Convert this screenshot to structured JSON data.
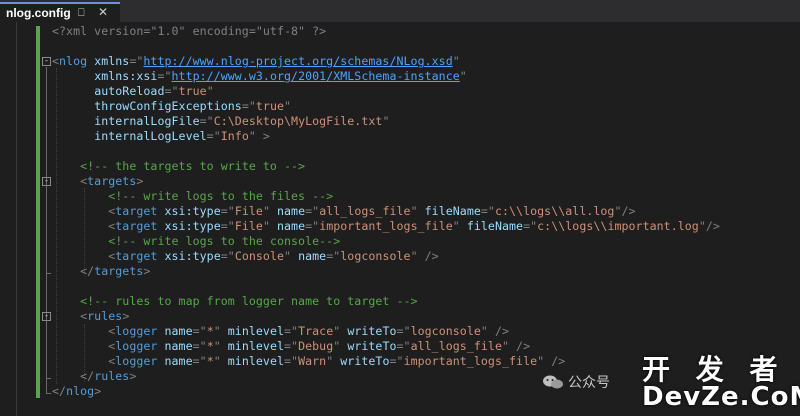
{
  "tab": {
    "title": "nlog.config",
    "pin_icon": "pin-icon",
    "close_icon": "close-icon"
  },
  "code": {
    "l1": {
      "s1": "<?xml version=\"1.0\" encoding=\"utf-8\" ?>"
    },
    "l2": {},
    "l3": {
      "s1": "<",
      "s2": "nlog",
      "s3": " ",
      "s4": "xmlns",
      "s5": "=\"",
      "s6": "http://www.nlog-project.org/schemas/NLog.xsd",
      "s7": "\""
    },
    "l4": {
      "s1": "      ",
      "s2": "xmlns:xsi",
      "s3": "=\"",
      "s4": "http://www.w3.org/2001/XMLSchema-instance",
      "s5": "\""
    },
    "l5": {
      "s1": "      ",
      "s2": "autoReload",
      "s3": "=\"",
      "s4": "true",
      "s5": "\""
    },
    "l6": {
      "s1": "      ",
      "s2": "throwConfigExceptions",
      "s3": "=\"",
      "s4": "true",
      "s5": "\""
    },
    "l7": {
      "s1": "      ",
      "s2": "internalLogFile",
      "s3": "=\"",
      "s4": "C:\\Desktop\\MyLogFile.txt",
      "s5": "\""
    },
    "l8": {
      "s1": "      ",
      "s2": "internalLogLevel",
      "s3": "=\"",
      "s4": "Info",
      "s5": "\" >"
    },
    "l9": {},
    "l10": {
      "s1": "    ",
      "s2": "<!-- the targets to write to -->"
    },
    "l11": {
      "s1": "    <",
      "s2": "targets",
      "s3": ">"
    },
    "l12": {
      "s1": "        ",
      "s2": "<!-- write logs to the files -->"
    },
    "l13": {
      "s1": "        <",
      "s2": "target",
      "s3": " ",
      "s4": "xsi:type",
      "s5": "=\"",
      "s6": "File",
      "s7": "\" ",
      "s8": "name",
      "s9": "=\"",
      "s10": "all_logs_file",
      "s11": "\" ",
      "s12": "fileName",
      "s13": "=\"",
      "s14": "c:\\\\logs\\\\all.log",
      "s15": "\"/>"
    },
    "l14": {
      "s1": "        <",
      "s2": "target",
      "s3": " ",
      "s4": "xsi:type",
      "s5": "=\"",
      "s6": "File",
      "s7": "\" ",
      "s8": "name",
      "s9": "=\"",
      "s10": "important_logs_file",
      "s11": "\" ",
      "s12": "fileName",
      "s13": "=\"",
      "s14": "c:\\\\logs\\\\important.log",
      "s15": "\"/>"
    },
    "l15": {
      "s1": "        ",
      "s2": "<!-- write logs to the console-->"
    },
    "l16": {
      "s1": "        <",
      "s2": "target",
      "s3": " ",
      "s4": "xsi:type",
      "s5": "=\"",
      "s6": "Console",
      "s7": "\" ",
      "s8": "name",
      "s9": "=\"",
      "s10": "logconsole",
      "s11": "\" />"
    },
    "l17": {
      "s1": "    </",
      "s2": "targets",
      "s3": ">"
    },
    "l18": {},
    "l19": {
      "s1": "    ",
      "s2": "<!-- rules to map from logger name to target -->"
    },
    "l20": {
      "s1": "    <",
      "s2": "rules",
      "s3": ">"
    },
    "l21": {
      "s1": "        <",
      "s2": "logger",
      "s3": " ",
      "s4": "name",
      "s5": "=\"",
      "s6": "*",
      "s7": "\" ",
      "s8": "minlevel",
      "s9": "=\"",
      "s10": "Trace",
      "s11": "\" ",
      "s12": "writeTo",
      "s13": "=\"",
      "s14": "logconsole",
      "s15": "\" />"
    },
    "l22": {
      "s1": "        <",
      "s2": "logger",
      "s3": " ",
      "s4": "name",
      "s5": "=\"",
      "s6": "*",
      "s7": "\" ",
      "s8": "minlevel",
      "s9": "=\"",
      "s10": "Debug",
      "s11": "\" ",
      "s12": "writeTo",
      "s13": "=\"",
      "s14": "all_logs_file",
      "s15": "\" />"
    },
    "l23": {
      "s1": "        <",
      "s2": "logger",
      "s3": " ",
      "s4": "name",
      "s5": "=\"",
      "s6": "*",
      "s7": "\" ",
      "s8": "minlevel",
      "s9": "=\"",
      "s10": "Warn",
      "s11": "\" ",
      "s12": "writeTo",
      "s13": "=\"",
      "s14": "important_logs_file",
      "s15": "\" />"
    },
    "l24": {
      "s1": "    </",
      "s2": "rules",
      "s3": ">"
    },
    "l25": {
      "s1": "</",
      "s2": "nlog",
      "s3": ">"
    }
  },
  "gutter": {
    "collapse_glyph": "-"
  },
  "watermark": {
    "label": "公众号",
    "brand_top": "开 发 者",
    "brand_bottom": "DevZe.CoM",
    "icon": "wechat-icon"
  },
  "colors": {
    "background": "#1e1e1e",
    "tag": "#569cd6",
    "attribute": "#9cdcfe",
    "value": "#ce9178",
    "comment": "#57a64a",
    "punctuation": "#808080",
    "link": "#4ea3ff",
    "change_bar": "#57a64a"
  }
}
